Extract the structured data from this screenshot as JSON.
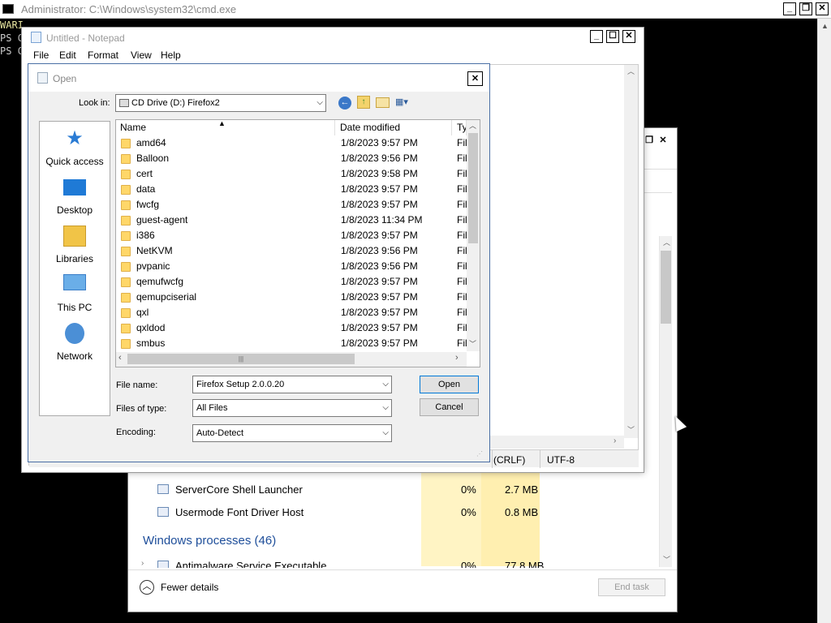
{
  "cmd": {
    "title": "Administrator: C:\\Windows\\system32\\cmd.exe",
    "lines": [
      "WARI",
      "PS C",
      "PS C"
    ]
  },
  "taskmanager": {
    "processes": [
      {
        "name": "ServerCore Shell Launcher",
        "cpu": "0%",
        "mem": "2.7 MB"
      },
      {
        "name": "Usermode Font Driver Host",
        "cpu": "0%",
        "mem": "0.8 MB"
      }
    ],
    "section": "Windows processes (46)",
    "partial_row": {
      "name": "Antimalware Service Executable",
      "cpu": "0%",
      "mem": "77.8 MB"
    },
    "fewer_details": "Fewer details",
    "end_task": "End task"
  },
  "notepad": {
    "title": "Untitled - Notepad",
    "menu": [
      "File",
      "Edit",
      "Format",
      "View",
      "Help"
    ],
    "status": {
      "eol": "(CRLF)",
      "encoding": "UTF-8"
    }
  },
  "dialog": {
    "title": "Open",
    "look_in_label": "Look in:",
    "look_in_value": "CD Drive (D:) Firefox2",
    "places": [
      "Quick access",
      "Desktop",
      "Libraries",
      "This PC",
      "Network"
    ],
    "columns": {
      "name": "Name",
      "date": "Date modified",
      "type": "Ty"
    },
    "files": [
      {
        "name": "amd64",
        "date": "1/8/2023 9:57 PM",
        "type": "Fil"
      },
      {
        "name": "Balloon",
        "date": "1/8/2023 9:56 PM",
        "type": "Fil"
      },
      {
        "name": "cert",
        "date": "1/8/2023 9:58 PM",
        "type": "Fil"
      },
      {
        "name": "data",
        "date": "1/8/2023 9:57 PM",
        "type": "Fil"
      },
      {
        "name": "fwcfg",
        "date": "1/8/2023 9:57 PM",
        "type": "Fil"
      },
      {
        "name": "guest-agent",
        "date": "1/8/2023 11:34 PM",
        "type": "Fil"
      },
      {
        "name": "i386",
        "date": "1/8/2023 9:57 PM",
        "type": "Fil"
      },
      {
        "name": "NetKVM",
        "date": "1/8/2023 9:56 PM",
        "type": "Fil"
      },
      {
        "name": "pvpanic",
        "date": "1/8/2023 9:56 PM",
        "type": "Fil"
      },
      {
        "name": "qemufwcfg",
        "date": "1/8/2023 9:57 PM",
        "type": "Fil"
      },
      {
        "name": "qemupciserial",
        "date": "1/8/2023 9:57 PM",
        "type": "Fil"
      },
      {
        "name": "qxl",
        "date": "1/8/2023 9:57 PM",
        "type": "Fil"
      },
      {
        "name": "qxldod",
        "date": "1/8/2023 9:57 PM",
        "type": "Fil"
      },
      {
        "name": "smbus",
        "date": "1/8/2023 9:57 PM",
        "type": "Fil"
      }
    ],
    "file_name_label": "File name:",
    "file_name_value": "Firefox Setup 2.0.0.20",
    "file_type_label": "Files of type:",
    "file_type_value": "All Files",
    "encoding_label": "Encoding:",
    "encoding_value": "Auto-Detect",
    "open_button": "Open",
    "cancel_button": "Cancel"
  }
}
